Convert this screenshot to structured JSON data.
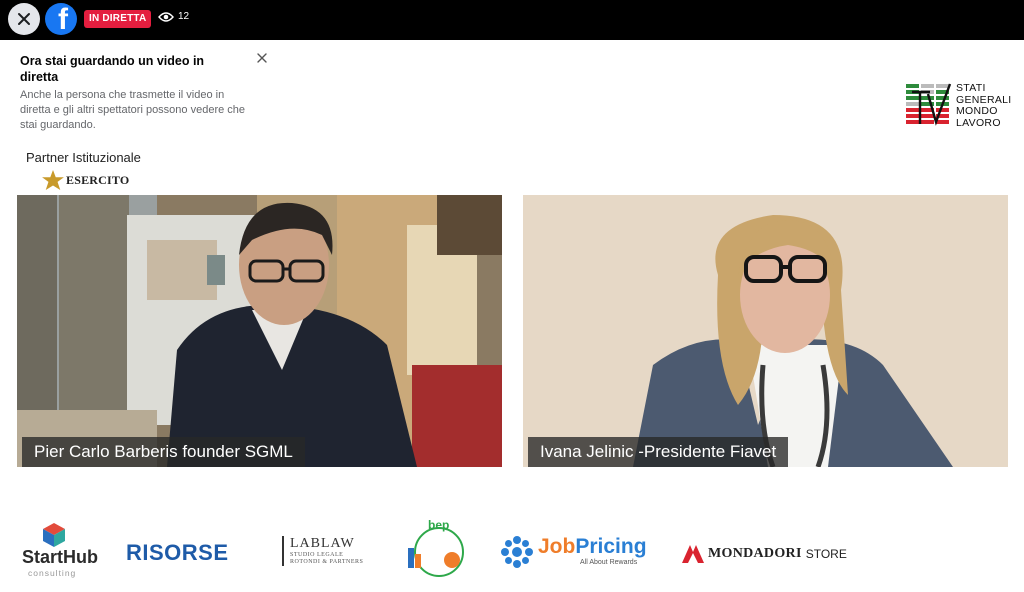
{
  "topbar": {
    "close_icon": "close-icon",
    "brand_icon": "facebook-logo",
    "live_label": "IN DIRETTA",
    "viewer_icon": "eye-icon",
    "viewer_count": "12",
    "live_color": "#e41e3f",
    "brand_color": "#1877f2"
  },
  "notice": {
    "title": "Ora stai guardando un video in diretta",
    "body": "Anche la persona che trasmette il video in diretta e gli altri spettatori possono vedere che stai guardando.",
    "close_icon": "close-icon"
  },
  "partner": {
    "label": "Partner Istituzionale",
    "name": "ESERCITO",
    "icon": "star-icon"
  },
  "sgml": {
    "line1": "STATI",
    "line2": "GENERALI",
    "line3": "MONDO",
    "line4": "LAVORO"
  },
  "videos": [
    {
      "caption": "Pier Carlo Barberis founder SGML"
    },
    {
      "caption": "Ivana Jelinic -Presidente Fiavet"
    }
  ],
  "sponsors": {
    "starthub": {
      "name": "StartHub",
      "sub": "consulting"
    },
    "risorse": {
      "name": "RISORSE"
    },
    "lablaw": {
      "name": "LABLAW",
      "sub1": "STUDIO LEGALE",
      "sub2": "ROTONDI & PARTNERS"
    },
    "bep": {
      "name": "bep"
    },
    "jobpricing": {
      "job": "Job",
      "pricing": "Pricing",
      "sub": "All About Rewards"
    },
    "mondadori": {
      "name": "MONDADORI",
      "store": "STORE"
    }
  }
}
